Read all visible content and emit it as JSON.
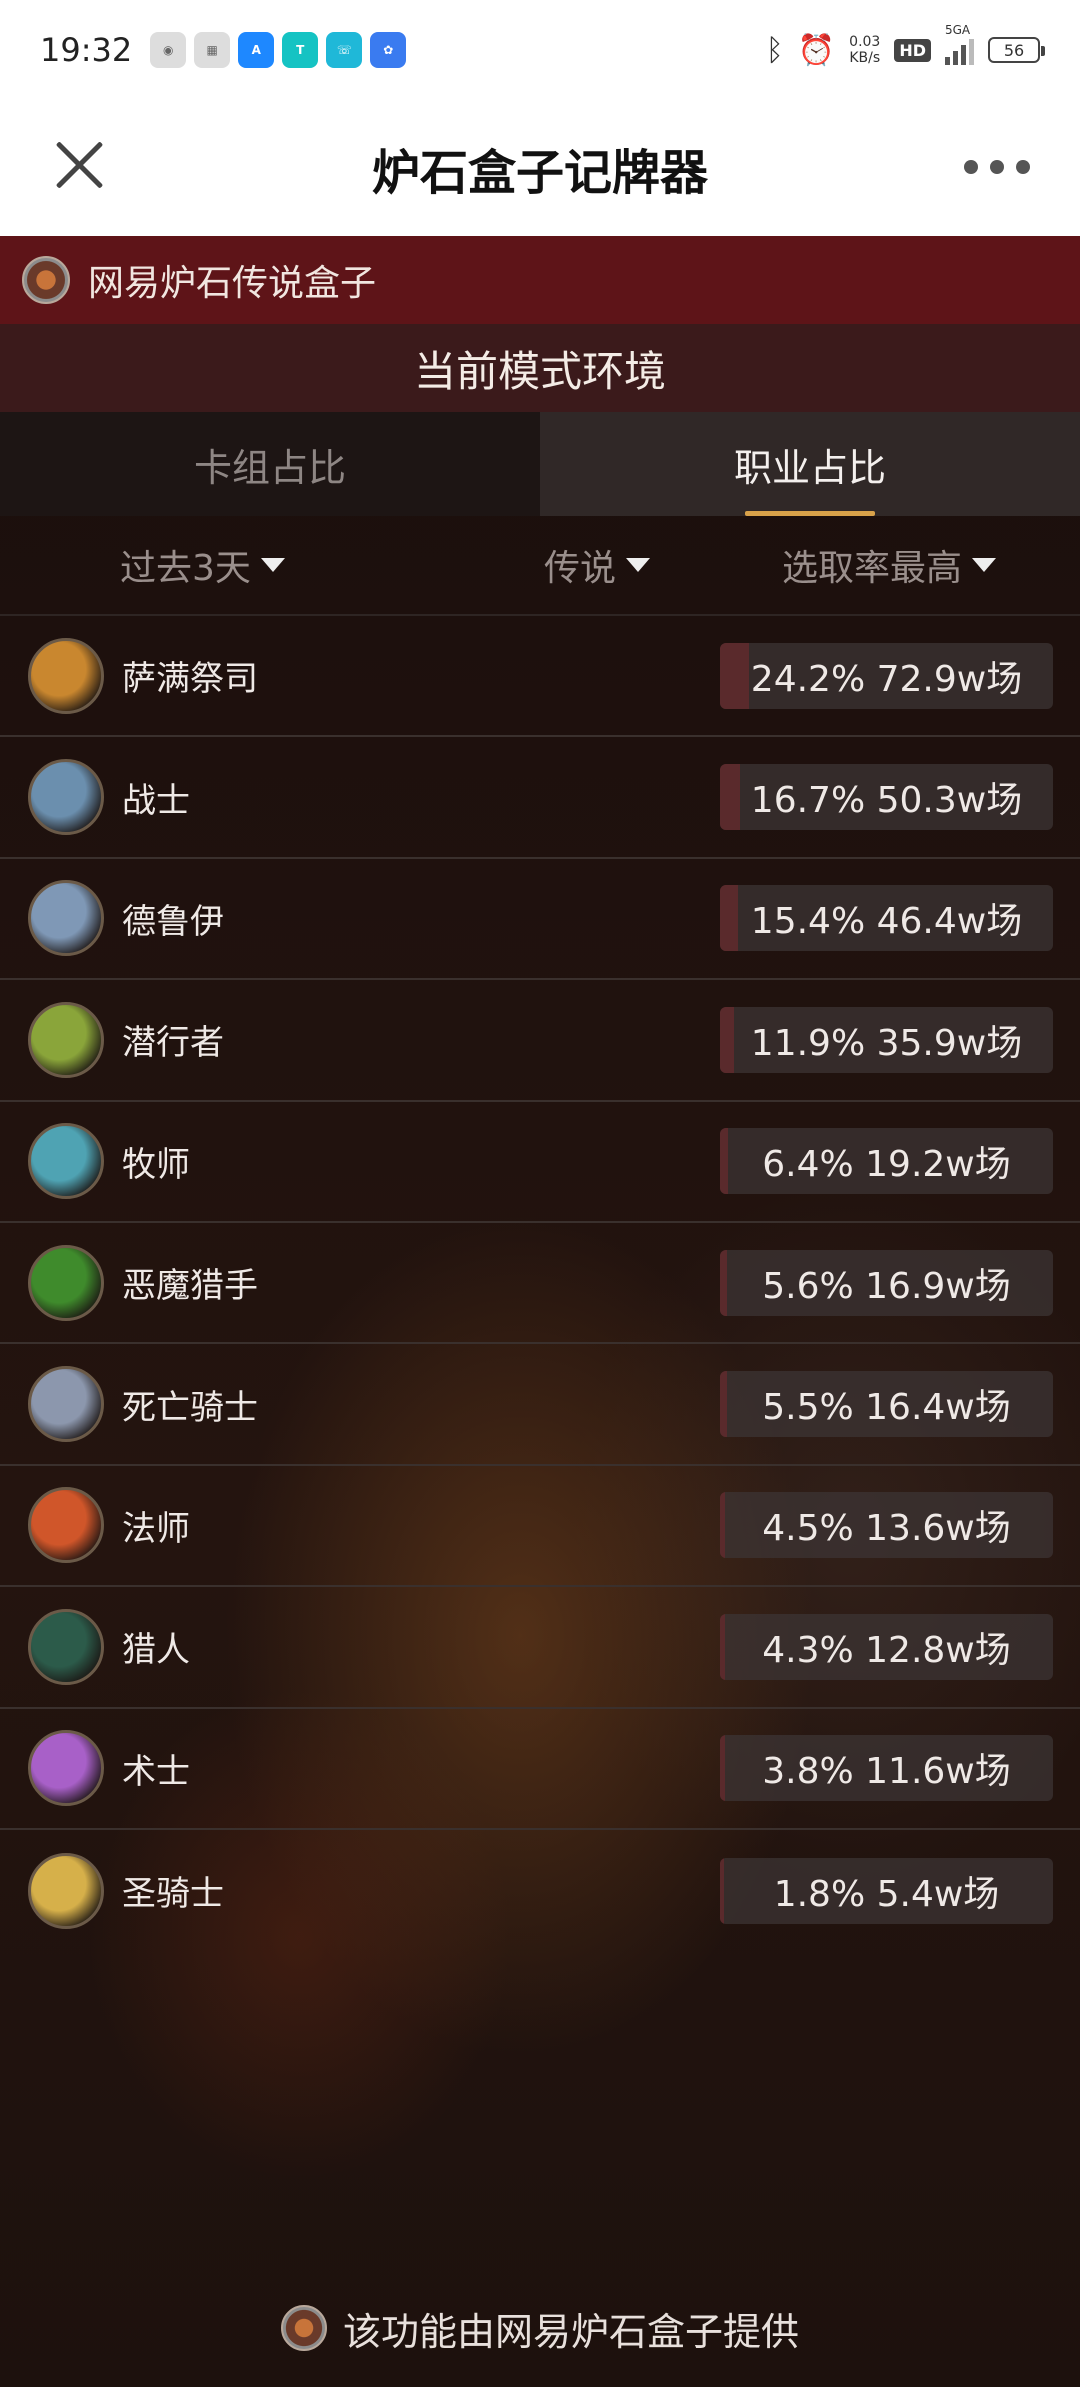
{
  "status_bar": {
    "time": "19:32",
    "net_speed_value": "0.03",
    "net_speed_unit": "KB/s",
    "hd_badge": "HD",
    "network": "5GA",
    "battery": "56",
    "notification_icons": [
      "weibo-icon",
      "app-icon",
      "alink-icon",
      "taptap-icon",
      "phone-icon",
      "gear-app-icon"
    ]
  },
  "titlebar": {
    "title": "炉石盒子记牌器"
  },
  "brand": {
    "name": "网易炉石传说盒子"
  },
  "mode": {
    "title": "当前模式环境"
  },
  "tabs": [
    {
      "label": "卡组占比",
      "active": false
    },
    {
      "label": "职业占比",
      "active": true
    }
  ],
  "filters": {
    "time_range": "过去3天",
    "rank": "传说",
    "sort": "选取率最高"
  },
  "classes": [
    {
      "name": "萨满祭司",
      "stat": "24.2% 72.9w场",
      "pick_rate": 24.2,
      "icon": "shaman-icon",
      "color": "#c9872f"
    },
    {
      "name": "战士",
      "stat": "16.7% 50.3w场",
      "pick_rate": 16.7,
      "icon": "warrior-icon",
      "color": "#6b8fae"
    },
    {
      "name": "德鲁伊",
      "stat": "15.4% 46.4w场",
      "pick_rate": 15.4,
      "icon": "druid-icon",
      "color": "#7f98b6"
    },
    {
      "name": "潜行者",
      "stat": "11.9% 35.9w场",
      "pick_rate": 11.9,
      "icon": "rogue-icon",
      "color": "#8aa53a"
    },
    {
      "name": "牧师",
      "stat": "6.4% 19.2w场",
      "pick_rate": 6.4,
      "icon": "priest-icon",
      "color": "#4fa3b3"
    },
    {
      "name": "恶魔猎手",
      "stat": "5.6% 16.9w场",
      "pick_rate": 5.6,
      "icon": "demon-hunter-icon",
      "color": "#3f8b2c"
    },
    {
      "name": "死亡骑士",
      "stat": "5.5% 16.4w场",
      "pick_rate": 5.5,
      "icon": "death-knight-icon",
      "color": "#8c97ad"
    },
    {
      "name": "法师",
      "stat": "4.5% 13.6w场",
      "pick_rate": 4.5,
      "icon": "mage-icon",
      "color": "#d0562a"
    },
    {
      "name": "猎人",
      "stat": "4.3% 12.8w场",
      "pick_rate": 4.3,
      "icon": "hunter-icon",
      "color": "#2c5b4a"
    },
    {
      "name": "术士",
      "stat": "3.8% 11.6w场",
      "pick_rate": 3.8,
      "icon": "warlock-icon",
      "color": "#a860c8"
    },
    {
      "name": "圣骑士",
      "stat": "1.8% 5.4w场",
      "pick_rate": 1.8,
      "icon": "paladin-icon",
      "color": "#d6b04a"
    }
  ],
  "footer": {
    "text": "该功能由网易炉石盒子提供"
  }
}
